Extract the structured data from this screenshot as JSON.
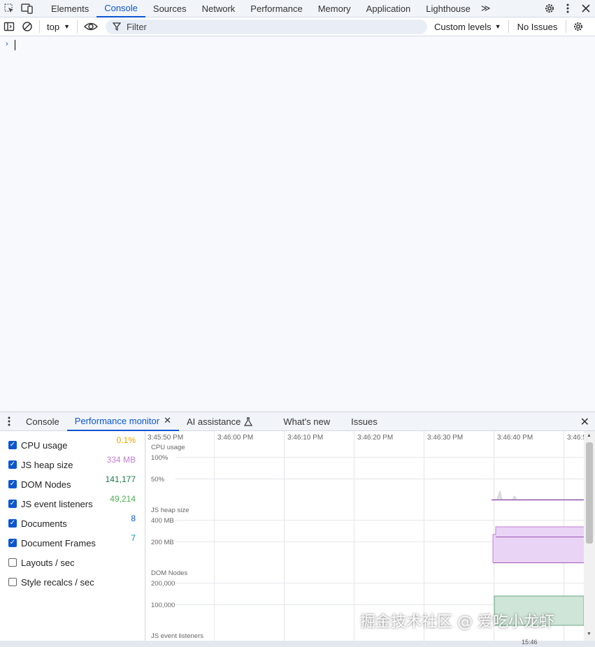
{
  "topbar": {
    "tabs": [
      "Elements",
      "Console",
      "Sources",
      "Network",
      "Performance",
      "Memory",
      "Application",
      "Lighthouse"
    ],
    "active_tab": "Console",
    "more_label": "≫",
    "icons": [
      "inspect-element-icon",
      "device-toolbar-icon",
      "settings-icon",
      "more-menu-icon",
      "close-icon"
    ]
  },
  "toolbar": {
    "context": "top",
    "filter_placeholder": "Filter",
    "levels": "Custom levels",
    "issues": "No Issues"
  },
  "console": {
    "prompt": "›"
  },
  "drawer": {
    "tabs": [
      "Console",
      "Performance monitor",
      "AI assistance",
      "What's new",
      "Issues"
    ],
    "active_tab": "Performance monitor"
  },
  "metrics": [
    {
      "label": "CPU usage",
      "value": "0.1%",
      "checked": true,
      "color": "#e8a400"
    },
    {
      "label": "JS heap size",
      "value": "334 MB",
      "checked": true,
      "color": "#c27ed4"
    },
    {
      "label": "DOM Nodes",
      "value": "141,177",
      "checked": true,
      "color": "#1e7a4c"
    },
    {
      "label": "JS event listeners",
      "value": "49,214",
      "checked": true,
      "color": "#4caf50"
    },
    {
      "label": "Documents",
      "value": "8",
      "checked": true,
      "color": "#0b57d0"
    },
    {
      "label": "Document Frames",
      "value": "7",
      "checked": true,
      "color": "#0b8fb5"
    },
    {
      "label": "Layouts / sec",
      "value": "",
      "checked": false,
      "color": "#333"
    },
    {
      "label": "Style recalcs / sec",
      "value": "",
      "checked": false,
      "color": "#333"
    }
  ],
  "timeline": {
    "times": [
      "3:45:50 PM",
      "3:46:00 PM",
      "3:46:10 PM",
      "3:46:20 PM",
      "3:46:30 PM",
      "3:46:40 PM",
      "3:46:5"
    ],
    "cpu": {
      "title": "CPU usage",
      "ticks": [
        "100%",
        "50%"
      ]
    },
    "heap": {
      "title": "JS heap size",
      "ticks": [
        "400 MB",
        "200 MB"
      ]
    },
    "dom": {
      "title": "DOM Nodes",
      "ticks": [
        "200,000",
        "100,000"
      ]
    },
    "listeners": {
      "title": "JS event listeners"
    },
    "bottom_time": "15:46"
  },
  "watermark": "掘金技术社区 @ 爱吃小龙虾"
}
